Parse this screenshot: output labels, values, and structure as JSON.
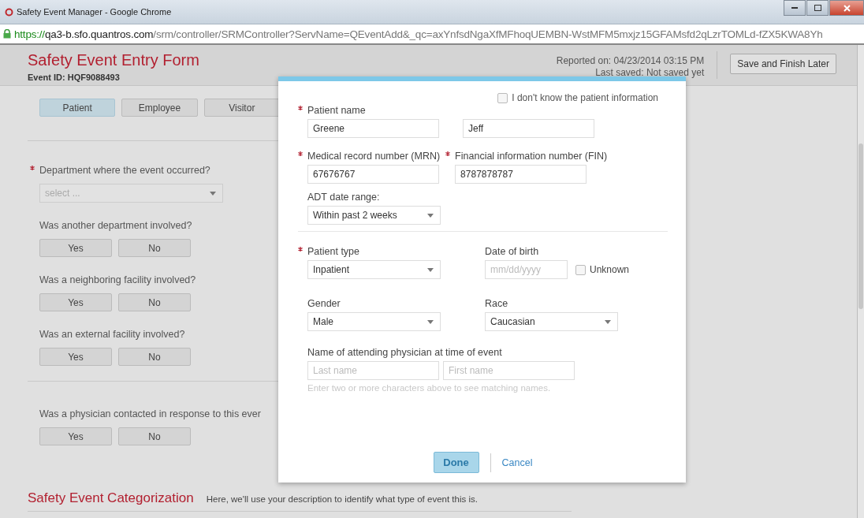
{
  "window": {
    "title": "Safety Event Manager - Google Chrome"
  },
  "address_bar": {
    "scheme": "https://",
    "host": "qa3-b.sfo.quantros.com",
    "path": "/srm/controller/SRMController?ServName=QEventAdd&_qc=axYnfsdNgaXfMFhoqUEMBN-WstMFM5mxjz15GFAMsfd2qLzrTOMLd-fZX5KWA8Yh"
  },
  "header": {
    "title": "Safety Event Entry Form",
    "event_id": "Event ID: HQF9088493",
    "reported_on": "Reported on: 04/23/2014 03:15 PM",
    "last_saved": "Last saved: Not saved yet",
    "save_button": "Save and Finish Later"
  },
  "sections": [
    [
      {
        "kind": "choice",
        "options": [
          {
            "label": "Patient",
            "selected": true
          },
          {
            "label": "Employee",
            "selected": false
          },
          {
            "label": "Visitor",
            "selected": false
          }
        ]
      }
    ],
    [
      {
        "kind": "select",
        "label": "Department where the event occurred?",
        "required": true,
        "placeholder": "select ..."
      },
      {
        "kind": "choice",
        "label": "Was another department involved?",
        "required": false,
        "options": [
          {
            "label": "Yes",
            "selected": false
          },
          {
            "label": "No",
            "selected": false
          }
        ]
      },
      {
        "kind": "choice",
        "label": "Was a neighboring facility involved?",
        "required": false,
        "options": [
          {
            "label": "Yes",
            "selected": false
          },
          {
            "label": "No",
            "selected": false
          }
        ]
      },
      {
        "kind": "choice",
        "label": "Was an external facility involved?",
        "required": false,
        "options": [
          {
            "label": "Yes",
            "selected": false
          },
          {
            "label": "No",
            "selected": false
          }
        ]
      }
    ],
    [
      {
        "kind": "choice",
        "label": "Was a physician contacted in response to this ever",
        "required": false,
        "options": [
          {
            "label": "Yes",
            "selected": false
          },
          {
            "label": "No",
            "selected": false
          }
        ]
      }
    ]
  ],
  "categorization": {
    "title": "Safety Event Categorization",
    "description": "Here, we'll use your description to identify what type of event this is."
  },
  "dialog": {
    "unknown_patient": {
      "label": "I don't know the patient information",
      "checked": false
    },
    "patient_name": {
      "label": "Patient name",
      "required": true,
      "last": "Greene",
      "first": "Jeff"
    },
    "mrn": {
      "label": "Medical record number (MRN)",
      "required": true,
      "value": "67676767"
    },
    "fin": {
      "label": "Financial information number (FIN)",
      "required": true,
      "value": "8787878787"
    },
    "adt": {
      "label": "ADT date range:",
      "value": "Within past 2 weeks"
    },
    "patient_type": {
      "label": "Patient type",
      "required": true,
      "value": "Inpatient"
    },
    "dob": {
      "label": "Date of birth",
      "placeholder": "mm/dd/yyyy",
      "unknown": {
        "label": "Unknown",
        "checked": false
      }
    },
    "gender": {
      "label": "Gender",
      "value": "Male"
    },
    "race": {
      "label": "Race",
      "value": "Caucasian"
    },
    "physician": {
      "label": "Name of attending physician at time of event",
      "last_placeholder": "Last name",
      "first_placeholder": "First name",
      "hint": "Enter two or more characters above to see matching names."
    },
    "done": "Done",
    "cancel": "Cancel"
  }
}
